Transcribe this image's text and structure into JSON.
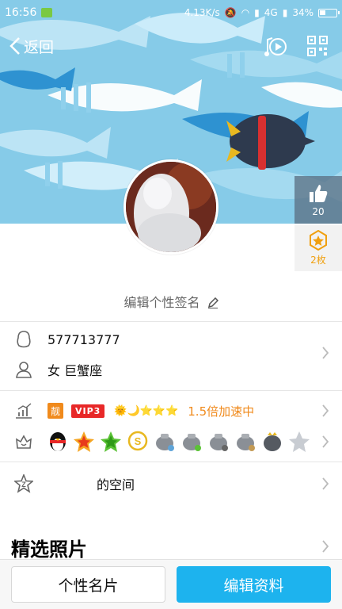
{
  "status_bar": {
    "time": "16:56",
    "network_speed": "4.13K/s",
    "network_type": "4G",
    "battery": "34%"
  },
  "nav": {
    "back_label": "返回",
    "icons": [
      "chevron-left-icon",
      "music-note-icon",
      "qr-code-icon"
    ]
  },
  "like": {
    "count": "20",
    "icon": "thumbs-up-icon"
  },
  "badge": {
    "label": "2枚",
    "icon": "star-badge-icon"
  },
  "signature": {
    "text": "编辑个性签名",
    "icon": "pencil-icon"
  },
  "profile": {
    "qq_number": "577713777",
    "gender_zodiac": "女  巨蟹座"
  },
  "level": {
    "liang_tag": "靓",
    "vip_tag": "VIP3",
    "stars": "🌞🌙⭐⭐⭐",
    "speed_text": "1.5倍加速中"
  },
  "space": {
    "label": "的空间"
  },
  "photos": {
    "title": "精选照片"
  },
  "buttons": {
    "card": "个性名片",
    "edit": "编辑资料"
  },
  "colors": {
    "accent": "#1db3ee",
    "orange": "#f08a1c",
    "vip_red": "#e82828"
  }
}
